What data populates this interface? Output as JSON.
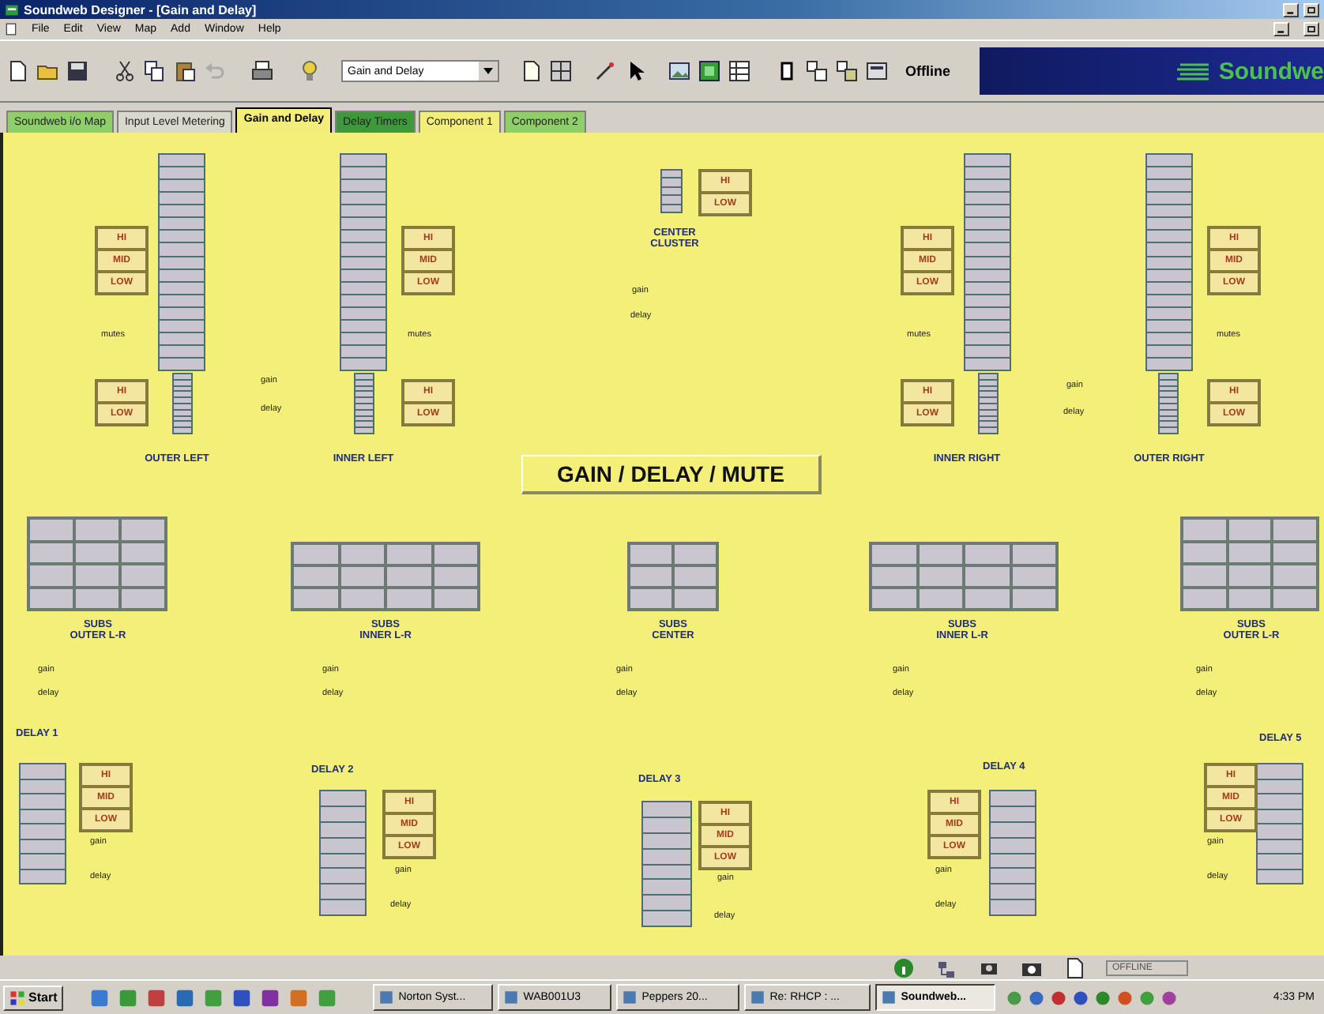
{
  "window": {
    "title": "Soundweb Designer - [Gain and Delay]"
  },
  "menu": [
    "File",
    "Edit",
    "View",
    "Map",
    "Add",
    "Window",
    "Help"
  ],
  "toolbar": {
    "dropdown": "Gain and Delay",
    "status": "Offline",
    "brand": "Soundwe"
  },
  "tabs": [
    {
      "label": "Soundweb i/o Map",
      "color": "#8fcf6a",
      "selected": false
    },
    {
      "label": "Input Level Metering",
      "color": "#d8d8cc",
      "selected": false
    },
    {
      "label": "Gain and Delay",
      "color": "#f3ee7a",
      "selected": true
    },
    {
      "label": "Delay Timers",
      "color": "#3d9a3a",
      "selected": false
    },
    {
      "label": "Component 1",
      "color": "#f3ee7a",
      "selected": false
    },
    {
      "label": "Component 2",
      "color": "#8fcf6a",
      "selected": false
    }
  ],
  "canvas": {
    "title": "GAIN / DELAY / MUTE",
    "arrays": [
      {
        "label": "OUTER LEFT",
        "upper_bands": [
          "HI",
          "MID",
          "LOW"
        ],
        "lower_bands": [
          "HI",
          "LOW"
        ],
        "mutes": "mutes",
        "gain": "gain",
        "delay": "delay"
      },
      {
        "label": "INNER LEFT",
        "upper_bands": [
          "HI",
          "MID",
          "LOW"
        ],
        "lower_bands": [
          "HI",
          "LOW"
        ],
        "mutes": "mutes"
      },
      {
        "label": "INNER RIGHT",
        "upper_bands": [
          "HI",
          "MID",
          "LOW"
        ],
        "lower_bands": [
          "HI",
          "LOW"
        ],
        "mutes": "mutes"
      },
      {
        "label": "OUTER RIGHT",
        "upper_bands": [
          "HI",
          "MID",
          "LOW"
        ],
        "lower_bands": [
          "HI",
          "LOW"
        ],
        "mutes": "mutes",
        "gain": "gain",
        "delay": "delay"
      }
    ],
    "center_cluster": {
      "label": "CENTER\nCLUSTER",
      "bands": [
        "HI",
        "LOW"
      ],
      "gain": "gain",
      "delay": "delay"
    },
    "subs": [
      {
        "label": "SUBS\nOUTER L-R",
        "gain": "gain",
        "delay": "delay"
      },
      {
        "label": "SUBS\nINNER L-R",
        "gain": "gain",
        "delay": "delay"
      },
      {
        "label": "SUBS\nCENTER",
        "gain": "gain",
        "delay": "delay"
      },
      {
        "label": "SUBS\nINNER L-R",
        "gain": "gain",
        "delay": "delay"
      },
      {
        "label": "SUBS\nOUTER L-R",
        "gain": "gain",
        "delay": "delay"
      }
    ],
    "delays": [
      {
        "label": "DELAY 1",
        "bands": [
          "HI",
          "MID",
          "LOW"
        ],
        "gain": "gain",
        "delay": "delay"
      },
      {
        "label": "DELAY 2",
        "bands": [
          "HI",
          "MID",
          "LOW"
        ],
        "gain": "gain",
        "delay": "delay"
      },
      {
        "label": "DELAY 3",
        "bands": [
          "HI",
          "MID",
          "LOW"
        ],
        "gain": "gain",
        "delay": "delay"
      },
      {
        "label": "DELAY 4",
        "bands": [
          "HI",
          "MID",
          "LOW"
        ],
        "gain": "gain",
        "delay": "delay"
      },
      {
        "label": "DELAY 5",
        "bands": [
          "HI",
          "MID",
          "LOW"
        ],
        "gain": "gain",
        "delay": "delay"
      }
    ]
  },
  "status_bar": {
    "mode": "OFFLINE"
  },
  "taskbar": {
    "start": "Start",
    "tasks": [
      {
        "label": "Norton Syst...",
        "selected": false
      },
      {
        "label": "WAB001U3",
        "selected": false
      },
      {
        "label": "Peppers 20...",
        "selected": false
      },
      {
        "label": "Re: RHCP : ...",
        "selected": false
      },
      {
        "label": "Soundweb...",
        "selected": true
      }
    ],
    "clock": "4:33 PM"
  }
}
